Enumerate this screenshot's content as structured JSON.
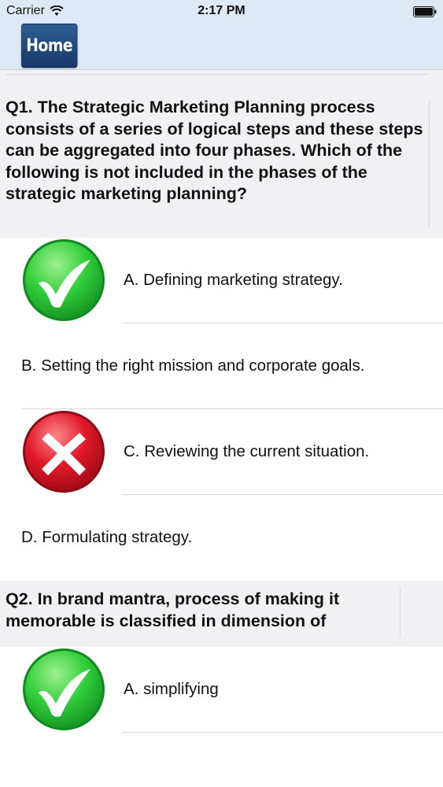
{
  "status": {
    "carrier": "Carrier",
    "time": "2:17 PM"
  },
  "nav": {
    "home_label": "Home"
  },
  "q1": {
    "text": "Q1. The Strategic Marketing Planning process consists of a series of logical steps and these steps can be aggregated into four phases. Which of the following is not included in the phases of the strategic marketing planning?",
    "options": [
      {
        "label": "A. Defining marketing strategy.",
        "mark": "check-icon"
      },
      {
        "label": "B. Setting the right mission and corporate goals.",
        "mark": ""
      },
      {
        "label": "C. Reviewing the current situation.",
        "mark": "cross-icon"
      },
      {
        "label": "D. Formulating strategy.",
        "mark": ""
      }
    ]
  },
  "q2": {
    "text": "Q2. In brand mantra, process of making it memorable is classified in dimension of",
    "options": [
      {
        "label": "A. simplifying",
        "mark": "check-icon"
      }
    ]
  },
  "colors": {
    "correct": "#2ecc40",
    "wrong": "#e0182a",
    "nav_bg": "#dde9f7",
    "question_bg": "#f1f1f3"
  }
}
